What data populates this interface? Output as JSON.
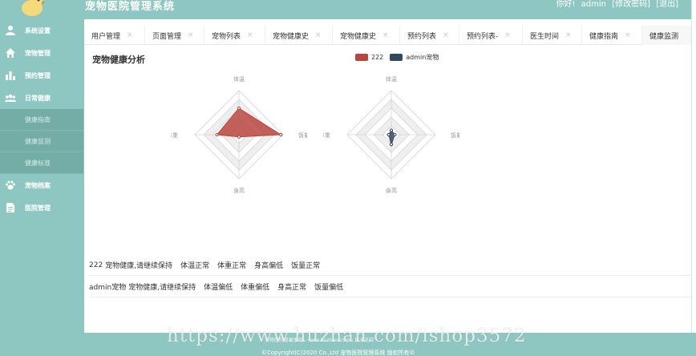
{
  "header": {
    "title": "宠物医院管理系统",
    "greeting": "你好!",
    "user": "admin",
    "change_password": "[修改密码]",
    "logout": "[退出]"
  },
  "sidebar": {
    "items": [
      {
        "label": "系统设置",
        "icon": "user-icon"
      },
      {
        "label": "宠物管理",
        "icon": "home-icon"
      },
      {
        "label": "预约管理",
        "icon": "bar-chart-icon"
      },
      {
        "label": "日常健康",
        "icon": "group-icon"
      }
    ],
    "subitems": [
      "健康指南",
      "健康监测",
      "健康标准"
    ],
    "items_after": [
      {
        "label": "宠物档案",
        "icon": "paw-icon"
      },
      {
        "label": "医院管理",
        "icon": "document-icon"
      }
    ]
  },
  "tabs": [
    {
      "label": "用户管理",
      "close": true
    },
    {
      "label": "页面管理",
      "close": true
    },
    {
      "label": "宠物列表",
      "close": true
    },
    {
      "label": "宠物健康史",
      "close": true
    },
    {
      "label": "宠物健康史",
      "close": true
    },
    {
      "label": "预约列表",
      "close": true
    },
    {
      "label": "预约列表-",
      "close": true
    },
    {
      "label": "医生时间",
      "close": true
    },
    {
      "label": "健康指南",
      "close": true
    },
    {
      "label": "健康监测",
      "close": false,
      "active": true
    }
  ],
  "close_glyph": "×",
  "main": {
    "title": "宠物健康分析"
  },
  "legend": [
    {
      "label": "222",
      "color": "#b8463f"
    },
    {
      "label": "admin宠物",
      "color": "#34495e"
    }
  ],
  "chart_data": [
    {
      "type": "radar",
      "indicators": [
        "体温",
        "饭量",
        "身高",
        "体重"
      ],
      "series": [
        {
          "name": "222",
          "values": [
            0.6,
            0.95,
            0.05,
            0.5
          ]
        }
      ],
      "color": "#b8463f",
      "range": [
        0,
        1
      ]
    },
    {
      "type": "radar",
      "indicators": [
        "体温",
        "饭量",
        "身高",
        "体重"
      ],
      "series": [
        {
          "name": "admin宠物",
          "values": [
            0.1,
            0.08,
            0.22,
            0.06
          ]
        }
      ],
      "color": "#34495e",
      "range": [
        0,
        1
      ]
    }
  ],
  "status": [
    {
      "pet": "222",
      "summary": "宠物健康,请继续保持",
      "items": [
        "体温正常",
        "体重正常",
        "身高偏低",
        "饭量正常"
      ]
    },
    {
      "pet": "admin宠物",
      "summary": "宠物健康,请继续保持",
      "items": [
        "体温偏低",
        "体重偏低",
        "身高正常",
        "饭量偏低"
      ]
    }
  ],
  "footer": {
    "line": "宠物医院管理系统 · www.huzhan.com · 技术支持",
    "copyright": "©Copyright(C)2020 Co.,Ltd 宠物医院管理系统 版权所有©"
  },
  "watermark": "https://www.huzhan.com/ishop3572"
}
